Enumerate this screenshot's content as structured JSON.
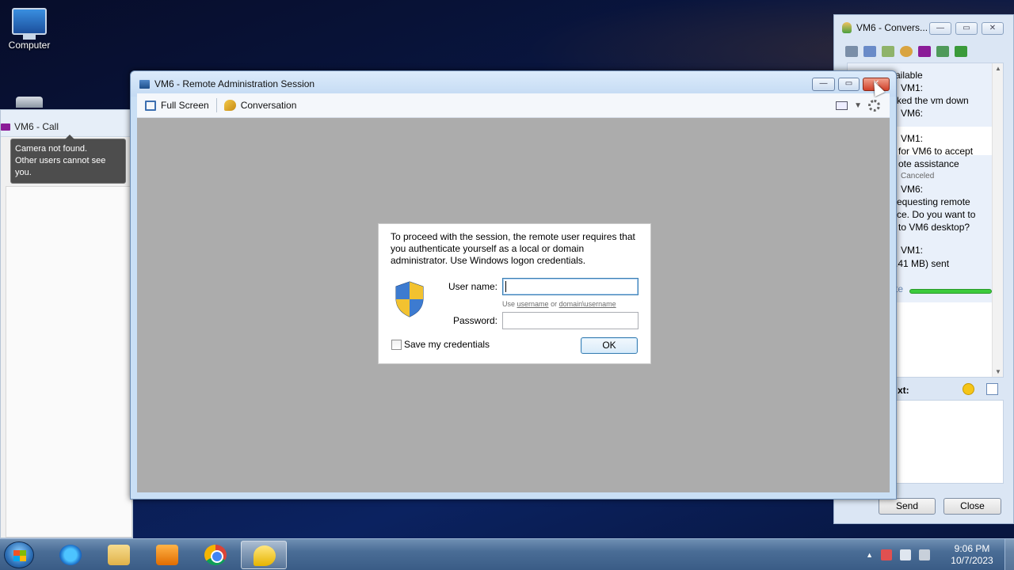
{
  "desktop": {
    "icons": [
      {
        "label": "Computer"
      }
    ]
  },
  "call_window": {
    "title": "VM6 - Call",
    "tooltip_line1": "Camera not found.",
    "tooltip_line2": "Other users cannot see you."
  },
  "conversation_window": {
    "title": "VM6 - Convers...",
    "history": [
      "ailable",
      "VM1:",
      "ked the vm down",
      "VM6:",
      "VM1:",
      "for VM6 to accept",
      "ote assistance",
      "Canceled",
      "VM6:",
      "equesting remote",
      "ce. Do you want to",
      "to VM6 desktop?",
      "VM1:",
      ".41 MB) sent",
      "te"
    ],
    "transfer_progress": 1.0,
    "input_label": "xt:",
    "send_label": "Send",
    "close_label": "Close"
  },
  "remote_window": {
    "title": "VM6 - Remote Administration Session",
    "toolbar": {
      "full_screen": "Full Screen",
      "conversation": "Conversation"
    }
  },
  "auth_dialog": {
    "message": "To proceed with the session, the remote user requires that you authenticate yourself as a local or domain administrator. Use Windows logon credentials.",
    "username_label": "User name:",
    "username_value": "",
    "hint_prefix": "Use",
    "hint_link1": "username",
    "hint_or": "or",
    "hint_link2": "domain\\username",
    "password_label": "Password:",
    "password_value": "",
    "save_credentials_label": "Save my credentials",
    "save_credentials_checked": false,
    "ok_label": "OK"
  },
  "taskbar": {
    "apps": [
      {
        "name": "internet-explorer-icon"
      },
      {
        "name": "folder-icon"
      },
      {
        "name": "media-player-icon"
      },
      {
        "name": "chrome-icon"
      },
      {
        "name": "lync-icon",
        "active": true
      }
    ],
    "clock_time": "9:06 PM",
    "clock_date": "10/7/2023"
  },
  "colors": {
    "accent": "#3c7fb1",
    "close_button": "#d0402a",
    "progress": "#3ccb3c",
    "remote_background": "#acacac"
  }
}
